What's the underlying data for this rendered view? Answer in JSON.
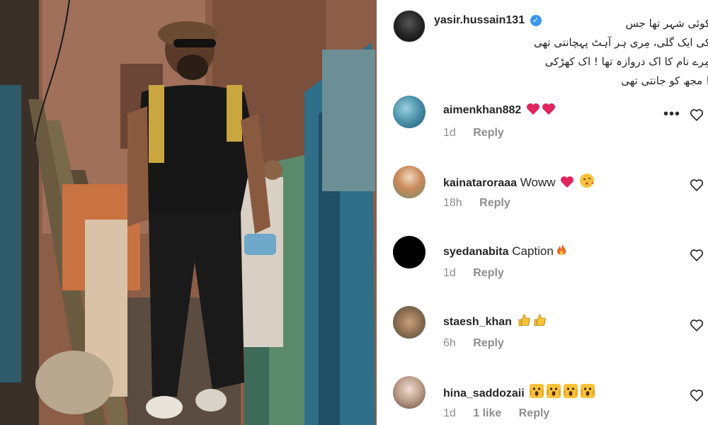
{
  "post": {
    "author": {
      "username": "yasir.hussain131",
      "verified_icon": "verified-badge-icon",
      "avatar_icon": "avatar"
    },
    "caption_lines": [
      "کوئی شہر تھا جس",
      "کی ایک گلی، مِری ہر آہٹ پہچانتی تھی",
      "مِرے نام کا اک دروازہ تھا ! اک کھڑکی",
      "! مجھ کو جانتی تھی"
    ],
    "photo_icon": "street-photo"
  },
  "comments": [
    {
      "username": "aimenkhan882",
      "text": "",
      "emoji": [
        "heart",
        "heart"
      ],
      "time": "1d",
      "likes": "",
      "reply_label": "Reply",
      "avatar_color": "#4a8fa8",
      "show_more": true
    },
    {
      "username": "kainataroraaa",
      "text": "Woww",
      "emoji": [
        "heart",
        "kiss-face"
      ],
      "time": "18h",
      "likes": "",
      "reply_label": "Reply",
      "avatar_color": "#c98a5a",
      "show_more": false
    },
    {
      "username": "syedanabita",
      "text": "Caption",
      "emoji": [
        "fire"
      ],
      "time": "1d",
      "likes": "",
      "reply_label": "Reply",
      "avatar_color": "#000000",
      "show_more": false
    },
    {
      "username": "staesh_khan",
      "text": "",
      "emoji": [
        "thumbs-up",
        "thumbs-up"
      ],
      "time": "6h",
      "likes": "",
      "reply_label": "Reply",
      "avatar_color": "#8a6a50",
      "show_more": false
    },
    {
      "username": "hina_saddozaii",
      "text": "",
      "emoji": [
        "scream",
        "scream",
        "scream",
        "scream"
      ],
      "time": "1d",
      "likes": "1 like",
      "reply_label": "Reply",
      "avatar_color": "#b99a88",
      "show_more": false
    }
  ],
  "colors": {
    "verified": "#3897f0",
    "heart_emoji": "#e0245e",
    "meta_text": "#8e8e8e"
  }
}
